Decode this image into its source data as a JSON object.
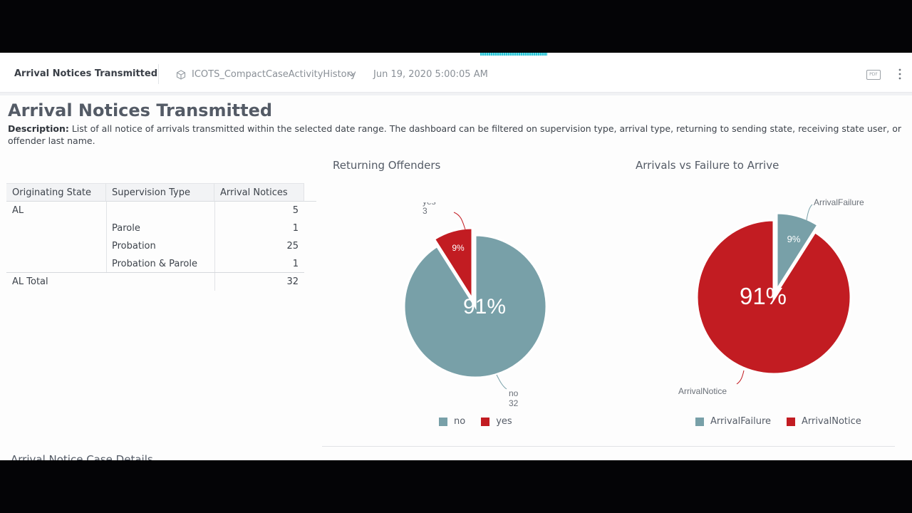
{
  "header": {
    "title": "Arrival Notices Transmitted",
    "datasource": "ICOTS_CompactCaseActivityHistory",
    "date": "Jun 19, 2020 5:00:05 AM",
    "pdf_label": "PDF"
  },
  "page": {
    "title": "Arrival Notices Transmitted",
    "description_label": "Description:",
    "description_text": " List of all notice of arrivals transmitted within the selected date range. The dashboard can be filtered on supervision type, arrival type, returning to sending state, receiving state user, or offender last name."
  },
  "pivot": {
    "headers": [
      "Originating State",
      "Supervision Type",
      "Arrival Notices"
    ],
    "rows": [
      {
        "state": "AL",
        "type": "",
        "value": "5"
      },
      {
        "state": "",
        "type": "Parole",
        "value": "1"
      },
      {
        "state": "",
        "type": "Probation",
        "value": "25"
      },
      {
        "state": "",
        "type": "Probation & Parole",
        "value": "1"
      }
    ],
    "total": {
      "label": "AL Total",
      "value": "32"
    }
  },
  "charts": {
    "returning": {
      "title": "Returning Offenders",
      "big_label": "91%",
      "small_label": "9%",
      "yes_name": "yes",
      "yes_count": "3",
      "no_name": "no",
      "no_count": "32",
      "legend": [
        "no",
        "yes"
      ]
    },
    "arrivals": {
      "title": "Arrivals vs Failure to Arrive",
      "big_label": "91%",
      "small_label": "9%",
      "failure_name": "ArrivalFailure",
      "notice_name": "ArrivalNotice",
      "legend": [
        "ArrivalFailure",
        "ArrivalNotice"
      ]
    }
  },
  "colors": {
    "teal": "#78a0a8",
    "red": "#c21c22",
    "accent": "#2bc4d6"
  },
  "chart_data": [
    {
      "type": "pie",
      "title": "Returning Offenders",
      "categories": [
        "no",
        "yes"
      ],
      "values": [
        32,
        3
      ],
      "percent_labels": [
        "91%",
        "9%"
      ]
    },
    {
      "type": "pie",
      "title": "Arrivals vs Failure to Arrive",
      "categories": [
        "ArrivalFailure",
        "ArrivalNotice"
      ],
      "percent_labels": [
        "9%",
        "91%"
      ]
    }
  ],
  "section": {
    "title": "Arrival Notice Case Details"
  }
}
